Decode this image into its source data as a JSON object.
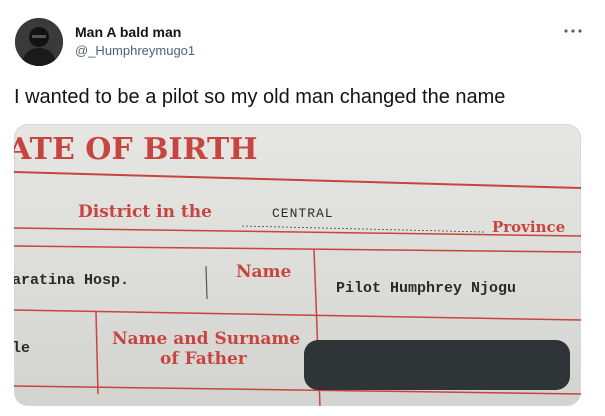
{
  "tweet": {
    "author": {
      "display_name": "Man A bald man",
      "handle": "@_Humphreymugo1"
    },
    "text": "I wanted to be a pilot so my old man changed the name",
    "more_icon": "ellipsis-icon"
  },
  "document": {
    "heading": "ATE OF BIRTH",
    "district_label": "District in the",
    "district_value": "CENTRAL",
    "province_label": "Province",
    "hospital_value": "aratina Hosp.",
    "name_label": "Name",
    "name_value": "Pilot Humphrey Njogu",
    "left_partial": "le",
    "father_label_line1": "Name and Surname",
    "father_label_line2": "of Father"
  },
  "colors": {
    "form_red": "#c8443f",
    "redaction": "#2f3437"
  }
}
